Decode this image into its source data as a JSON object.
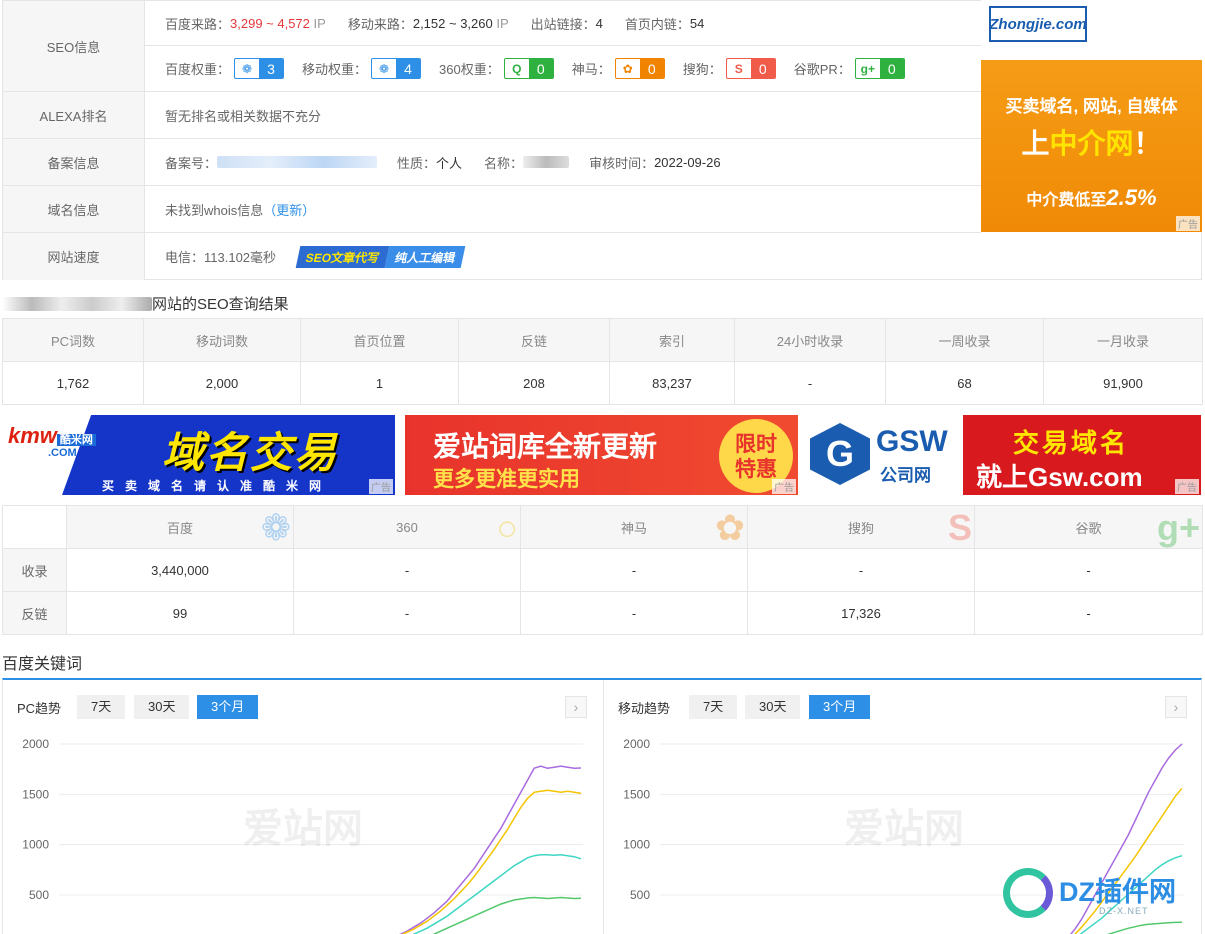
{
  "seo": {
    "label": "SEO信息",
    "baidu_traffic_label": "百度来路：",
    "baidu_traffic": "3,299 ~ 4,572",
    "ip1": "IP",
    "mobile_traffic_label": "移动来路：",
    "mobile_traffic": "2,152 ~ 3,260",
    "ip2": "IP",
    "outlinks_label": "出站链接：",
    "outlinks": "4",
    "inlinks_label": "首页内链：",
    "inlinks": "54",
    "weights": [
      {
        "label": "百度权重：",
        "value": "3",
        "icon": "baidu-paw-icon",
        "color": "#2d8fe6"
      },
      {
        "label": "移动权重：",
        "value": "4",
        "icon": "baidu-paw-icon",
        "color": "#2d8fe6"
      },
      {
        "label": "360权重：",
        "value": "0",
        "icon": "360-icon",
        "color": "#2fb140"
      },
      {
        "label": "神马：",
        "value": "0",
        "icon": "shenma-icon",
        "color": "#f08300"
      },
      {
        "label": "搜狗：",
        "value": "0",
        "icon": "sogou-icon",
        "color": "#f05b4a"
      },
      {
        "label": "谷歌PR：",
        "value": "0",
        "icon": "google-plus-icon",
        "color": "#2fb140"
      }
    ]
  },
  "alexa": {
    "label": "ALEXA排名",
    "value": "暂无排名或相关数据不充分"
  },
  "beian": {
    "label": "备案信息",
    "no_label": "备案号：",
    "type_label": "性质：",
    "type": "个人",
    "name_label": "名称：",
    "time_label": "审核时间：",
    "time": "2022-09-26"
  },
  "whois": {
    "label": "域名信息",
    "value": "未找到whois信息",
    "update": "（更新）"
  },
  "speed": {
    "label": "网站速度",
    "value": "电信：113.102毫秒",
    "banner_a": "SEO文章代写",
    "banner_b": "纯人工编辑"
  },
  "ad_right": {
    "logo": "Zhongjie.com",
    "line1": "买卖域名, 网站, 自媒体",
    "line2a": "上",
    "line2b": "中介网",
    "line2c": "！",
    "line3a": "中介费低至",
    "line3b": "2.5%",
    "ad": "广告"
  },
  "result_title": "网站的SEO查询结果",
  "word_table": {
    "headers": [
      "PC词数",
      "移动词数",
      "首页位置",
      "反链",
      "索引",
      "24小时收录",
      "一周收录",
      "一月收录"
    ],
    "values": [
      "1,762",
      "2,000",
      "1",
      "208",
      "83,237",
      "-",
      "68",
      "91,900"
    ]
  },
  "banners": {
    "b1": {
      "brand": "kmw",
      "brand_cn": "酷米网",
      "brand_com": ".COM",
      "big": "域名交易",
      "small": "买卖域名请认准酷米网",
      "ad": "广告"
    },
    "b2": {
      "t1": "爱站词库全新更新",
      "t2": "更多更准更实用",
      "circle": "限时特惠",
      "ad": "广告"
    },
    "b3": {
      "logo": "G",
      "gsw": "GSW",
      "gsw2": "公司网",
      "r1": "交易域名",
      "r2": "就上Gsw.com",
      "ad": "广告"
    }
  },
  "engine_table": {
    "engines": [
      {
        "name": "百度",
        "icon": "baidu-paw-icon",
        "color": "#2d8fe6"
      },
      {
        "name": "360",
        "icon": "360-search-icon",
        "color": "#f5c400"
      },
      {
        "name": "神马",
        "icon": "shenma-icon",
        "color": "#f08300"
      },
      {
        "name": "搜狗",
        "icon": "sogou-icon",
        "color": "#f05b4a"
      },
      {
        "name": "谷歌",
        "icon": "google-plus-icon",
        "color": "#2fb140"
      }
    ],
    "rows": [
      {
        "label": "收录",
        "values": [
          "3,440,000",
          "-",
          "-",
          "-",
          "-"
        ]
      },
      {
        "label": "反链",
        "values": [
          "99",
          "-",
          "-",
          "17,326",
          "-"
        ]
      }
    ]
  },
  "keywords_title": "百度关键词",
  "pc_panel": {
    "title": "PC趋势",
    "btns": [
      "7天",
      "30天",
      "3个月"
    ],
    "active": 2
  },
  "mobile_panel": {
    "title": "移动趋势",
    "btns": [
      "7天",
      "30天",
      "3个月"
    ],
    "active": 2
  },
  "watermark": "爱站网",
  "dz_logo": {
    "text": "DZ插件网",
    "sub": "DZ-X.NET"
  },
  "chart_data": [
    {
      "type": "line",
      "title": "PC趋势",
      "ylim": [
        0,
        2000
      ],
      "yticks": [
        "2000",
        "1500",
        "1000",
        "500"
      ],
      "series": [
        {
          "color": "#a96be0",
          "values": [
            0,
            0,
            0,
            0,
            0,
            0,
            0,
            0,
            0,
            0,
            0,
            0,
            0,
            0,
            0,
            0,
            0,
            0,
            0,
            0,
            0,
            0,
            0,
            0,
            0,
            0,
            0,
            0,
            0,
            0,
            0,
            0,
            0,
            0,
            0,
            0,
            0,
            0,
            0,
            0,
            0,
            0,
            0,
            0,
            0,
            0,
            0,
            20,
            40,
            60,
            80,
            110,
            140,
            180,
            220,
            270,
            320,
            380,
            440,
            520,
            600,
            680,
            760,
            860,
            960,
            1060,
            1160,
            1280,
            1400,
            1520,
            1640,
            1760,
            1780,
            1760,
            1770,
            1780,
            1770,
            1760,
            1762
          ]
        },
        {
          "color": "#f5c400",
          "values": [
            0,
            0,
            0,
            0,
            0,
            0,
            0,
            0,
            0,
            0,
            0,
            0,
            0,
            0,
            0,
            0,
            0,
            0,
            0,
            0,
            0,
            0,
            0,
            0,
            0,
            0,
            0,
            0,
            0,
            0,
            0,
            0,
            0,
            0,
            0,
            0,
            0,
            0,
            0,
            0,
            0,
            0,
            0,
            0,
            0,
            0,
            0,
            10,
            30,
            50,
            70,
            100,
            130,
            160,
            200,
            240,
            290,
            340,
            400,
            460,
            530,
            600,
            680,
            770,
            860,
            950,
            1050,
            1150,
            1260,
            1370,
            1460,
            1520,
            1530,
            1540,
            1530,
            1520,
            1530,
            1520,
            1510
          ]
        },
        {
          "color": "#3dd6c3",
          "values": [
            0,
            0,
            0,
            0,
            0,
            0,
            0,
            0,
            0,
            0,
            0,
            0,
            0,
            0,
            0,
            0,
            0,
            0,
            0,
            0,
            0,
            0,
            0,
            0,
            0,
            0,
            0,
            0,
            0,
            0,
            0,
            0,
            0,
            0,
            0,
            0,
            0,
            0,
            0,
            0,
            0,
            0,
            0,
            0,
            0,
            0,
            0,
            0,
            10,
            20,
            40,
            60,
            80,
            110,
            140,
            170,
            210,
            250,
            290,
            340,
            390,
            440,
            490,
            540,
            590,
            640,
            690,
            740,
            790,
            830,
            870,
            890,
            900,
            900,
            895,
            900,
            890,
            880,
            860
          ]
        },
        {
          "color": "#52c86b",
          "values": [
            0,
            0,
            0,
            0,
            0,
            0,
            0,
            0,
            0,
            0,
            0,
            0,
            0,
            0,
            0,
            0,
            0,
            0,
            0,
            0,
            0,
            0,
            0,
            0,
            0,
            0,
            0,
            0,
            0,
            0,
            0,
            0,
            0,
            0,
            0,
            0,
            0,
            0,
            0,
            0,
            0,
            0,
            0,
            0,
            0,
            0,
            0,
            0,
            0,
            0,
            10,
            20,
            30,
            50,
            70,
            90,
            110,
            140,
            170,
            200,
            230,
            260,
            290,
            320,
            350,
            380,
            410,
            430,
            450,
            460,
            470,
            475,
            470,
            465,
            470,
            475,
            470,
            465,
            468
          ]
        },
        {
          "color": "#4aa8ff",
          "values": [
            0,
            0,
            0,
            0,
            0,
            0,
            0,
            0,
            0,
            0,
            0,
            0,
            0,
            0,
            0,
            0,
            0,
            0,
            0,
            0,
            0,
            0,
            0,
            0,
            0,
            0,
            0,
            0,
            0,
            0,
            0,
            0,
            0,
            0,
            0,
            0,
            0,
            0,
            0,
            0,
            0,
            0,
            0,
            0,
            0,
            0,
            0,
            0,
            0,
            0,
            0,
            0,
            0,
            0,
            0,
            0,
            0,
            0,
            0,
            5,
            8,
            10,
            12,
            14,
            16,
            18,
            20,
            20,
            20,
            20,
            20,
            20,
            20,
            20,
            20,
            20,
            20,
            20,
            20
          ]
        }
      ]
    },
    {
      "type": "line",
      "title": "移动趋势",
      "ylim": [
        0,
        2000
      ],
      "yticks": [
        "2000",
        "1500",
        "1000",
        "500"
      ],
      "series": [
        {
          "color": "#a96be0",
          "values": [
            0,
            0,
            0,
            0,
            0,
            0,
            0,
            0,
            0,
            0,
            0,
            0,
            0,
            0,
            0,
            0,
            0,
            0,
            0,
            0,
            0,
            0,
            0,
            0,
            0,
            0,
            0,
            0,
            0,
            0,
            0,
            0,
            0,
            0,
            0,
            0,
            0,
            0,
            0,
            0,
            0,
            0,
            0,
            0,
            0,
            0,
            0,
            0,
            0,
            0,
            0,
            0,
            0,
            0,
            0,
            0,
            0,
            0,
            0,
            0,
            20,
            80,
            160,
            260,
            380,
            500,
            620,
            740,
            860,
            980,
            1100,
            1240,
            1380,
            1520,
            1640,
            1760,
            1860,
            1940,
            2000
          ]
        },
        {
          "color": "#f5c400",
          "values": [
            0,
            0,
            0,
            0,
            0,
            0,
            0,
            0,
            0,
            0,
            0,
            0,
            0,
            0,
            0,
            0,
            0,
            0,
            0,
            0,
            0,
            0,
            0,
            0,
            0,
            0,
            0,
            0,
            0,
            0,
            0,
            0,
            0,
            0,
            0,
            0,
            0,
            0,
            0,
            0,
            0,
            0,
            0,
            0,
            0,
            0,
            0,
            0,
            0,
            0,
            0,
            0,
            0,
            0,
            0,
            0,
            0,
            0,
            0,
            0,
            10,
            50,
            110,
            180,
            260,
            340,
            430,
            520,
            610,
            700,
            790,
            880,
            980,
            1080,
            1180,
            1280,
            1380,
            1480,
            1560
          ]
        },
        {
          "color": "#3dd6c3",
          "values": [
            0,
            0,
            0,
            0,
            0,
            0,
            0,
            0,
            0,
            0,
            0,
            0,
            0,
            0,
            0,
            0,
            0,
            0,
            0,
            0,
            0,
            0,
            0,
            0,
            0,
            0,
            0,
            0,
            0,
            0,
            0,
            0,
            0,
            0,
            0,
            0,
            0,
            0,
            0,
            0,
            0,
            0,
            0,
            0,
            0,
            0,
            0,
            0,
            0,
            0,
            0,
            0,
            0,
            0,
            0,
            0,
            0,
            0,
            0,
            0,
            5,
            30,
            70,
            120,
            170,
            220,
            270,
            330,
            390,
            450,
            510,
            570,
            630,
            690,
            750,
            800,
            840,
            870,
            890
          ]
        },
        {
          "color": "#52c86b",
          "values": [
            0,
            0,
            0,
            0,
            0,
            0,
            0,
            0,
            0,
            0,
            0,
            0,
            0,
            0,
            0,
            0,
            0,
            0,
            0,
            0,
            0,
            0,
            0,
            0,
            0,
            0,
            0,
            0,
            0,
            0,
            0,
            0,
            0,
            0,
            0,
            0,
            0,
            0,
            0,
            0,
            0,
            0,
            0,
            0,
            0,
            0,
            0,
            0,
            0,
            0,
            0,
            0,
            0,
            0,
            0,
            0,
            0,
            0,
            0,
            0,
            0,
            5,
            15,
            30,
            50,
            70,
            90,
            110,
            130,
            150,
            170,
            185,
            200,
            210,
            215,
            220,
            225,
            228,
            230
          ]
        }
      ]
    }
  ]
}
